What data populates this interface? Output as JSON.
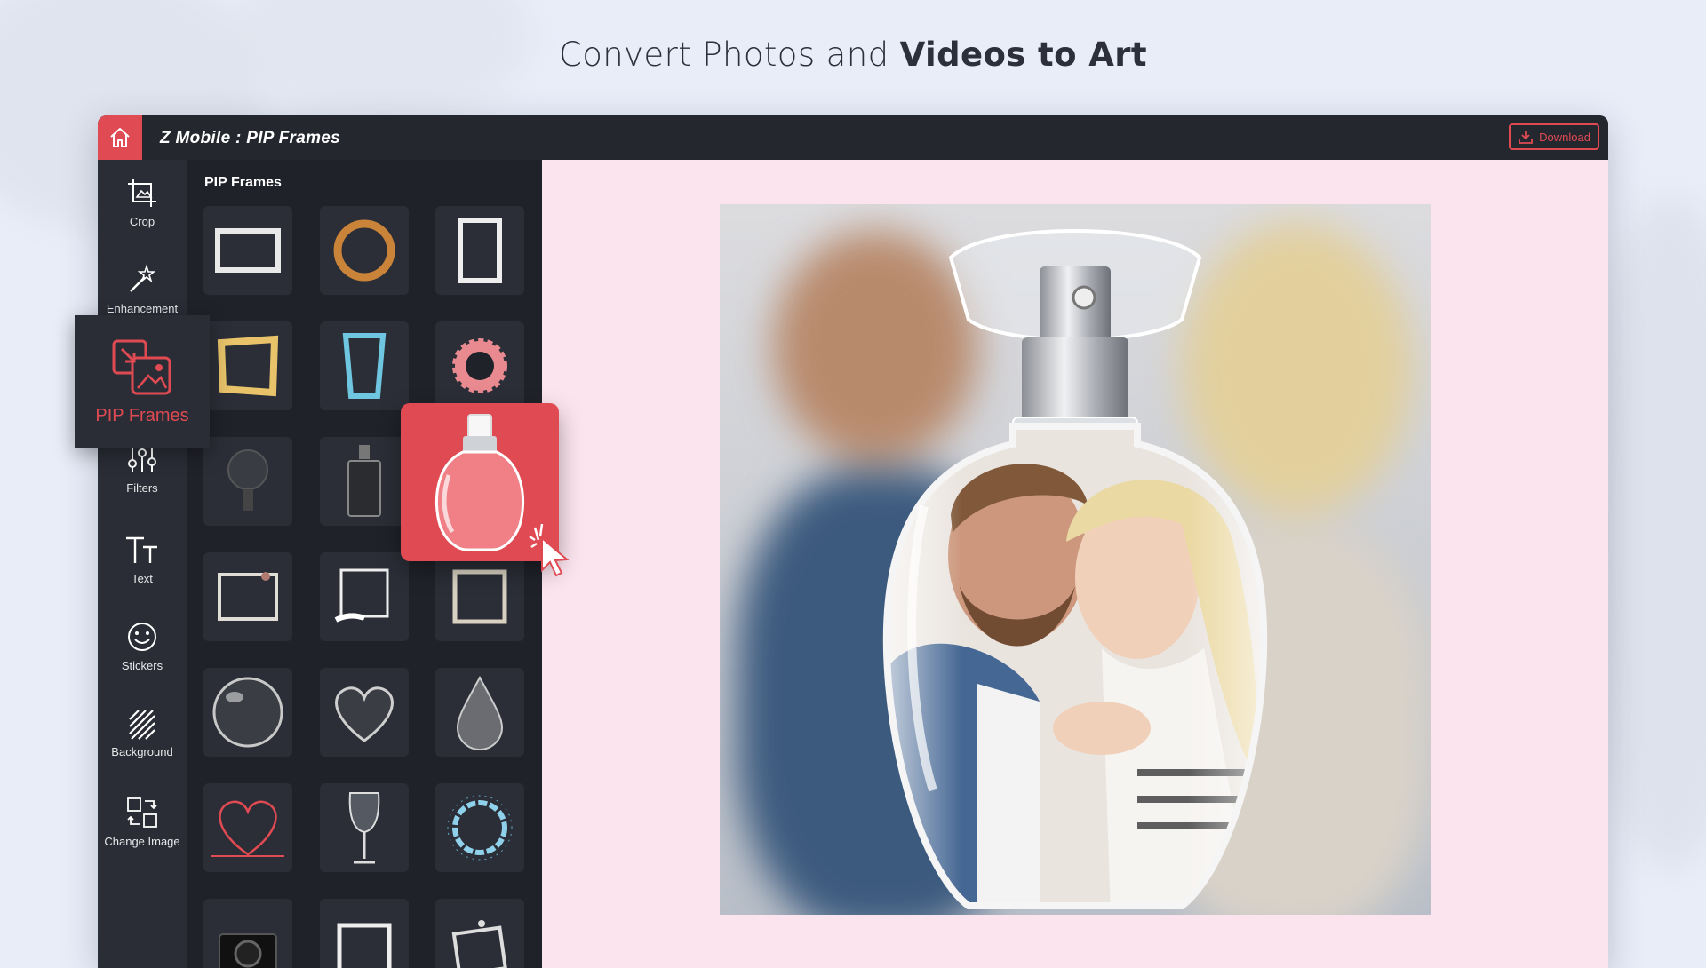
{
  "headline": {
    "part1": "Convert Photos and ",
    "part2": "Videos to Art"
  },
  "app": {
    "title": "Z Mobile : PIP Frames",
    "download_label": "Download"
  },
  "colors": {
    "accent": "#e04a52",
    "background": "#e9edf8",
    "canvas": "#fce4ee"
  },
  "toolbar": {
    "items": [
      {
        "label": "Crop",
        "icon": "crop-icon"
      },
      {
        "label": "Enhancement",
        "icon": "magic-wand-icon"
      },
      {
        "label": "PIP Frames",
        "icon": "pip-frames-icon",
        "active": true
      },
      {
        "label": "Filters",
        "icon": "sliders-icon"
      },
      {
        "label": "Text",
        "icon": "text-icon"
      },
      {
        "label": "Stickers",
        "icon": "smiley-icon"
      },
      {
        "label": "Background",
        "icon": "hatch-icon"
      },
      {
        "label": "Change Image",
        "icon": "swap-image-icon"
      }
    ]
  },
  "panel": {
    "title": "PIP Frames",
    "frames": [
      "white-rectangle-frame",
      "gold-ring-frame",
      "white-portrait-frame",
      "gold-square-frame",
      "blue-mirror-frame",
      "pink-flower-frame",
      "lightbulb-frame",
      "black-perfume-frame",
      "red-perfume-frame",
      "floral-dark-frame",
      "brush-square-frame",
      "rustic-square-frame",
      "bubble-frame",
      "heart-frame",
      "droplet-frame",
      "red-heart-outline-frame",
      "wine-glass-frame",
      "water-splash-ring-frame",
      "camera-frame",
      "black-square-frame",
      "polaroid-frame"
    ],
    "selected": "red-perfume-frame"
  }
}
